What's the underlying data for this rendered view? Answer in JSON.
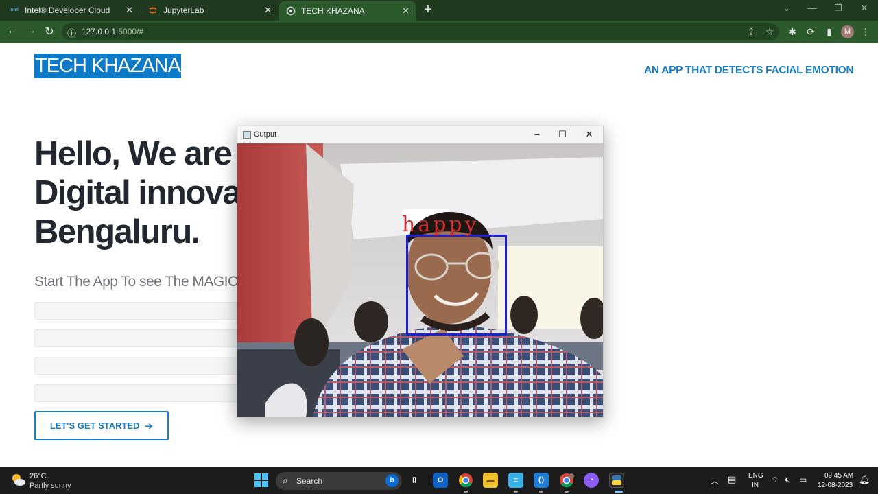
{
  "browser": {
    "tabs": [
      {
        "title": "Intel® Developer Cloud",
        "favicon": "intel-icon",
        "active": false
      },
      {
        "title": "JupyterLab",
        "favicon": "jupyter-icon",
        "active": false
      },
      {
        "title": "TECH KHAZANA",
        "favicon": "app-icon",
        "active": true
      }
    ],
    "url_host": "127.0.0.1",
    "url_path": ":5000/#",
    "profile_initial": "M"
  },
  "page": {
    "brand": "TECH KHAZANA",
    "tagline": "AN APP THAT DETECTS FACIAL EMOTION",
    "hero_lines": [
      "Hello, We are",
      "Digital innova",
      "Bengaluru."
    ],
    "subtitle": "Start The App To see The MAGIC",
    "cta_label": "LET'S GET STARTED",
    "accent_color": "#1a7fc1"
  },
  "output_window": {
    "title": "Output",
    "emotion_label": "happy",
    "label_color": "#d22b2b",
    "box_color": "#1f1fd6"
  },
  "taskbar": {
    "temperature": "26°C",
    "condition": "Partly sunny",
    "search_label": "Search",
    "lang_top": "ENG",
    "lang_bottom": "IN",
    "time": "09:45 AM",
    "date": "12-08-2023"
  }
}
